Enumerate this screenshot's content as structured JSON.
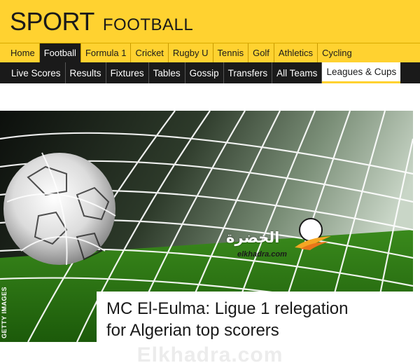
{
  "header": {
    "brand": "SPORT",
    "section": "FOOTBALL",
    "background_color": "#ffd230"
  },
  "primary_nav": {
    "items": [
      {
        "label": "Home",
        "active": false
      },
      {
        "label": "Football",
        "active": true
      },
      {
        "label": "Formula 1",
        "active": false
      },
      {
        "label": "Cricket",
        "active": false
      },
      {
        "label": "Rugby U",
        "active": false
      },
      {
        "label": "Tennis",
        "active": false
      },
      {
        "label": "Golf",
        "active": false
      },
      {
        "label": "Athletics",
        "active": false
      },
      {
        "label": "Cycling",
        "active": false
      }
    ]
  },
  "secondary_nav": {
    "items": [
      {
        "label": "Live Scores",
        "active": false
      },
      {
        "label": "Results",
        "active": false
      },
      {
        "label": "Fixtures",
        "active": false
      },
      {
        "label": "Tables",
        "active": false
      },
      {
        "label": "Gossip",
        "active": false
      },
      {
        "label": "Transfers",
        "active": false
      },
      {
        "label": "All Teams",
        "active": false
      },
      {
        "label": "Leagues & Cups",
        "active": true
      }
    ]
  },
  "hero": {
    "credit": "GETTY IMAGES",
    "image_icon": "football-in-net-image"
  },
  "headline": {
    "line1": "MC El-Eulma: Ligue 1 relegation",
    "line2": "for Algerian top scorers"
  },
  "watermark": {
    "arabic_name": "الخضرة",
    "url": "elkhadra.com",
    "footer_text": "Elkhadra.com"
  }
}
